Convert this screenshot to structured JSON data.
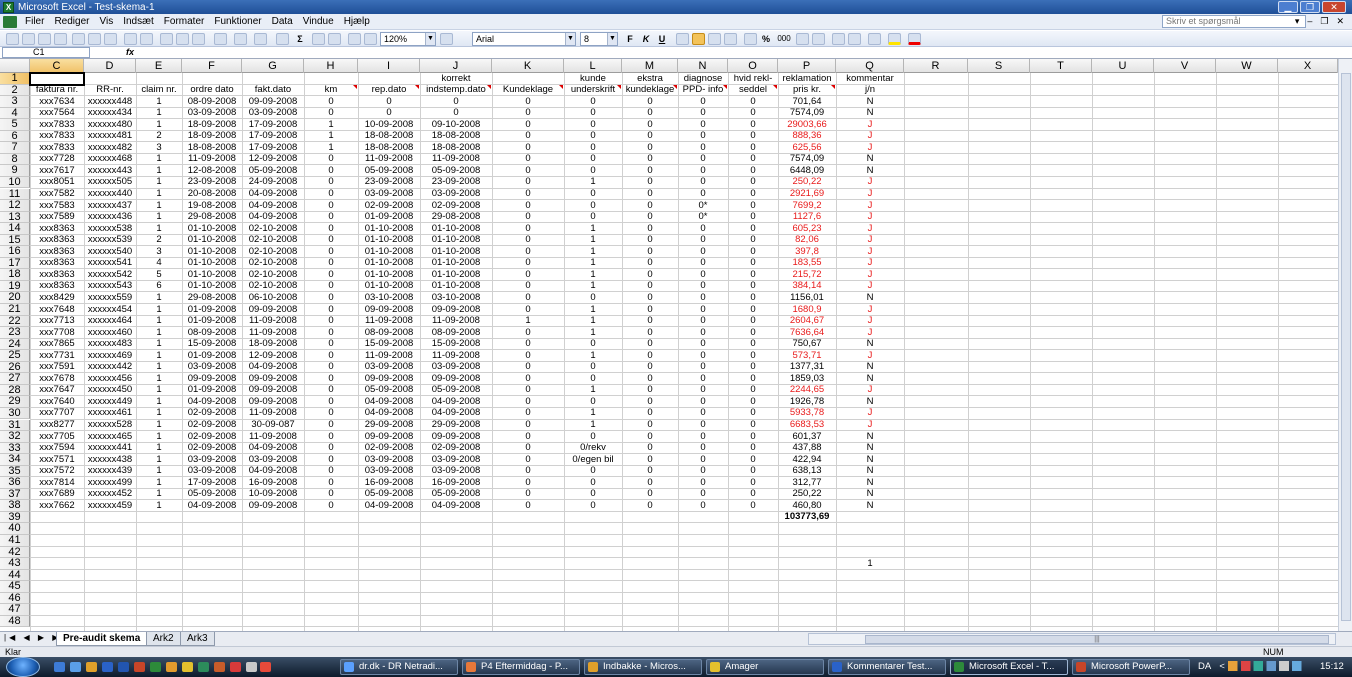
{
  "window": {
    "title": "Microsoft Excel - Test-skema-1",
    "icon_name": "excel-icon"
  },
  "menu": [
    "Filer",
    "Rediger",
    "Vis",
    "Indsæt",
    "Formater",
    "Funktioner",
    "Data",
    "Vindue",
    "Hjælp"
  ],
  "help_box": {
    "placeholder": "Skriv et spørgsmål"
  },
  "toolbar": {
    "zoom": "120%",
    "font": "Arial",
    "font_size": "8",
    "sum_symbol": "Σ",
    "bold_label": "F",
    "italic_label": "K",
    "underline_label": "U",
    "percent": "%",
    "thousands": "000"
  },
  "formula_bar": {
    "name_box": "C1",
    "fx": "fx",
    "content": ""
  },
  "columns": [
    "C",
    "D",
    "E",
    "F",
    "G",
    "H",
    "I",
    "J",
    "K",
    "L",
    "M",
    "N",
    "O",
    "P",
    "Q",
    "R",
    "S",
    "T",
    "U",
    "V",
    "W",
    "X"
  ],
  "rows": [
    "1",
    "2",
    "3",
    "4",
    "5",
    "6",
    "7",
    "8",
    "9",
    "10",
    "11",
    "12",
    "13",
    "14",
    "15",
    "16",
    "17",
    "18",
    "19",
    "20",
    "21",
    "22",
    "23",
    "24",
    "25",
    "26",
    "27",
    "28",
    "29",
    "30",
    "31",
    "32",
    "33",
    "34",
    "35",
    "36",
    "37",
    "38",
    "39",
    "40",
    "41",
    "42",
    "43",
    "44",
    "45",
    "46",
    "47",
    "48"
  ],
  "header_row1": [
    "",
    "",
    "",
    "",
    "",
    "",
    "",
    "korrekt",
    "",
    "kunde",
    "ekstra",
    "diagnose",
    "hvid rekl-",
    "reklamation",
    "kommentar"
  ],
  "header_row2": [
    "faktura nr.",
    "RR-nr.",
    "claim nr.",
    "ordre dato",
    "fakt.dato",
    "km",
    "rep.dato",
    "indstemp.dato",
    "Kundeklage",
    "underskrift",
    "kundeklage",
    "PPD- info",
    "seddel",
    "pris kr.",
    "j/n"
  ],
  "data_rows": [
    [
      "xxx7634",
      "xxxxxx448",
      "1",
      "08-09-2008",
      "09-09-2008",
      "0",
      "0",
      "0",
      "0",
      "0",
      "0",
      "0",
      "0",
      "701,64",
      "N"
    ],
    [
      "xxx7564",
      "xxxxxx434",
      "1",
      "03-09-2008",
      "03-09-2008",
      "0",
      "0",
      "0",
      "0",
      "0",
      "0",
      "0",
      "0",
      "7574,09",
      "N"
    ],
    [
      "xxx7833",
      "xxxxxx480",
      "1",
      "18-09-2008",
      "17-09-2008",
      "1",
      "10-09-2008",
      "09-10-2008",
      "0",
      "0",
      "0",
      "0",
      "0",
      "29003,66",
      "J"
    ],
    [
      "xxx7833",
      "xxxxxx481",
      "2",
      "18-09-2008",
      "17-09-2008",
      "1",
      "18-08-2008",
      "18-08-2008",
      "0",
      "0",
      "0",
      "0",
      "0",
      "888,36",
      "J"
    ],
    [
      "xxx7833",
      "xxxxxx482",
      "3",
      "18-08-2008",
      "17-09-2008",
      "1",
      "18-08-2008",
      "18-08-2008",
      "0",
      "0",
      "0",
      "0",
      "0",
      "625,56",
      "J"
    ],
    [
      "xxx7728",
      "xxxxxx468",
      "1",
      "11-09-2008",
      "12-09-2008",
      "0",
      "11-09-2008",
      "11-09-2008",
      "0",
      "0",
      "0",
      "0",
      "0",
      "7574,09",
      "N"
    ],
    [
      "xxx7617",
      "xxxxxx443",
      "1",
      "12-08-2008",
      "05-09-2008",
      "0",
      "05-09-2008",
      "05-09-2008",
      "0",
      "0",
      "0",
      "0",
      "0",
      "6448,09",
      "N"
    ],
    [
      "xxx8051",
      "xxxxxx505",
      "1",
      "23-09-2008",
      "24-09-2008",
      "0",
      "23-09-2008",
      "23-09-2008",
      "0",
      "1",
      "0",
      "0",
      "0",
      "250,22",
      "J"
    ],
    [
      "xxx7582",
      "xxxxxx440",
      "1",
      "20-08-2008",
      "04-09-2008",
      "0",
      "03-09-2008",
      "03-09-2008",
      "0",
      "0",
      "0",
      "0",
      "0",
      "2921,69",
      "J"
    ],
    [
      "xxx7583",
      "xxxxxx437",
      "1",
      "19-08-2008",
      "04-09-2008",
      "0",
      "02-09-2008",
      "02-09-2008",
      "0",
      "0",
      "0",
      "0*",
      "0",
      "7699,2",
      "J"
    ],
    [
      "xxx7589",
      "xxxxxx436",
      "1",
      "29-08-2008",
      "04-09-2008",
      "0",
      "01-09-2008",
      "29-08-2008",
      "0",
      "0",
      "0",
      "0*",
      "0",
      "1127,6",
      "J"
    ],
    [
      "xxx8363",
      "xxxxxx538",
      "1",
      "01-10-2008",
      "02-10-2008",
      "0",
      "01-10-2008",
      "01-10-2008",
      "0",
      "1",
      "0",
      "0",
      "0",
      "605,23",
      "J"
    ],
    [
      "xxx8363",
      "xxxxxx539",
      "2",
      "01-10-2008",
      "02-10-2008",
      "0",
      "01-10-2008",
      "01-10-2008",
      "0",
      "1",
      "0",
      "0",
      "0",
      "82,06",
      "J"
    ],
    [
      "xxx8363",
      "xxxxxx540",
      "3",
      "01-10-2008",
      "02-10-2008",
      "0",
      "01-10-2008",
      "01-10-2008",
      "0",
      "1",
      "0",
      "0",
      "0",
      "397,8",
      "J"
    ],
    [
      "xxx8363",
      "xxxxxx541",
      "4",
      "01-10-2008",
      "02-10-2008",
      "0",
      "01-10-2008",
      "01-10-2008",
      "0",
      "1",
      "0",
      "0",
      "0",
      "183,55",
      "J"
    ],
    [
      "xxx8363",
      "xxxxxx542",
      "5",
      "01-10-2008",
      "02-10-2008",
      "0",
      "01-10-2008",
      "01-10-2008",
      "0",
      "1",
      "0",
      "0",
      "0",
      "215,72",
      "J"
    ],
    [
      "xxx8363",
      "xxxxxx543",
      "6",
      "01-10-2008",
      "02-10-2008",
      "0",
      "01-10-2008",
      "01-10-2008",
      "0",
      "1",
      "0",
      "0",
      "0",
      "384,14",
      "J"
    ],
    [
      "xxx8429",
      "xxxxxx559",
      "1",
      "29-08-2008",
      "06-10-2008",
      "0",
      "03-10-2008",
      "03-10-2008",
      "0",
      "0",
      "0",
      "0",
      "0",
      "1156,01",
      "N"
    ],
    [
      "xxx7648",
      "xxxxxx454",
      "1",
      "01-09-2008",
      "09-09-2008",
      "0",
      "09-09-2008",
      "09-09-2008",
      "0",
      "1",
      "0",
      "0",
      "0",
      "1680,9",
      "J"
    ],
    [
      "xxx7713",
      "xxxxxx464",
      "1",
      "01-09-2008",
      "11-09-2008",
      "0",
      "11-09-2008",
      "11-09-2008",
      "1",
      "1",
      "0",
      "0",
      "0",
      "2604,67",
      "J"
    ],
    [
      "xxx7708",
      "xxxxxx460",
      "1",
      "08-09-2008",
      "11-09-2008",
      "0",
      "08-09-2008",
      "08-09-2008",
      "0",
      "1",
      "0",
      "0",
      "0",
      "7636,64",
      "J"
    ],
    [
      "xxx7865",
      "xxxxxx483",
      "1",
      "15-09-2008",
      "18-09-2008",
      "0",
      "15-09-2008",
      "15-09-2008",
      "0",
      "0",
      "0",
      "0",
      "0",
      "750,67",
      "N"
    ],
    [
      "xxx7731",
      "xxxxxx469",
      "1",
      "01-09-2008",
      "12-09-2008",
      "0",
      "11-09-2008",
      "11-09-2008",
      "0",
      "1",
      "0",
      "0",
      "0",
      "573,71",
      "J"
    ],
    [
      "xxx7591",
      "xxxxxx442",
      "1",
      "03-09-2008",
      "04-09-2008",
      "0",
      "03-09-2008",
      "03-09-2008",
      "0",
      "0",
      "0",
      "0",
      "0",
      "1377,31",
      "N"
    ],
    [
      "xxx7678",
      "xxxxxx456",
      "1",
      "09-09-2008",
      "09-09-2008",
      "0",
      "09-09-2008",
      "09-09-2008",
      "0",
      "0",
      "0",
      "0",
      "0",
      "1859,03",
      "N"
    ],
    [
      "xxx7647",
      "xxxxxx450",
      "1",
      "01-09-2008",
      "09-09-2008",
      "0",
      "05-09-2008",
      "05-09-2008",
      "0",
      "1",
      "0",
      "0",
      "0",
      "2244,65",
      "J"
    ],
    [
      "xxx7640",
      "xxxxxx449",
      "1",
      "04-09-2008",
      "09-09-2008",
      "0",
      "04-09-2008",
      "04-09-2008",
      "0",
      "0",
      "0",
      "0",
      "0",
      "1926,78",
      "N"
    ],
    [
      "xxx7707",
      "xxxxxx461",
      "1",
      "02-09-2008",
      "11-09-2008",
      "0",
      "04-09-2008",
      "04-09-2008",
      "0",
      "1",
      "0",
      "0",
      "0",
      "5933,78",
      "J"
    ],
    [
      "xxx8277",
      "xxxxxx528",
      "1",
      "02-09-2008",
      "30-09-087",
      "0",
      "29-09-2008",
      "29-09-2008",
      "0",
      "1",
      "0",
      "0",
      "0",
      "6683,53",
      "J"
    ],
    [
      "xxx7705",
      "xxxxxx465",
      "1",
      "02-09-2008",
      "11-09-2008",
      "0",
      "09-09-2008",
      "09-09-2008",
      "0",
      "0",
      "0",
      "0",
      "0",
      "601,37",
      "N"
    ],
    [
      "xxx7594",
      "xxxxxx441",
      "1",
      "02-09-2008",
      "04-09-2008",
      "0",
      "02-09-2008",
      "02-09-2008",
      "0",
      "0/rekv",
      "0",
      "0",
      "0",
      "437,88",
      "N"
    ],
    [
      "xxx7571",
      "xxxxxx438",
      "1",
      "03-09-2008",
      "03-09-2008",
      "0",
      "03-09-2008",
      "03-09-2008",
      "0",
      "0/egen bil",
      "0",
      "0",
      "0",
      "422,94",
      "N"
    ],
    [
      "xxx7572",
      "xxxxxx439",
      "1",
      "03-09-2008",
      "04-09-2008",
      "0",
      "03-09-2008",
      "03-09-2008",
      "0",
      "0",
      "0",
      "0",
      "0",
      "638,13",
      "N"
    ],
    [
      "xxx7814",
      "xxxxxx499",
      "1",
      "17-09-2008",
      "16-09-2008",
      "0",
      "16-09-2008",
      "16-09-2008",
      "0",
      "0",
      "0",
      "0",
      "0",
      "312,77",
      "N"
    ],
    [
      "xxx7689",
      "xxxxxx452",
      "1",
      "05-09-2008",
      "10-09-2008",
      "0",
      "05-09-2008",
      "05-09-2008",
      "0",
      "0",
      "0",
      "0",
      "0",
      "250,22",
      "N"
    ],
    [
      "xxx7662",
      "xxxxxx459",
      "1",
      "04-09-2008",
      "09-09-2008",
      "0",
      "04-09-2008",
      "04-09-2008",
      "0",
      "0",
      "0",
      "0",
      "0",
      "460,80",
      "N"
    ]
  ],
  "total": "103773,69",
  "q43_value": "1",
  "sheets": [
    "Pre-audit skema",
    "Ark2",
    "Ark3"
  ],
  "status": {
    "left": "Klar",
    "num": "NUM"
  },
  "taskbar": {
    "tasks": [
      "dr.dk - DR Netradi...",
      "P4 Eftermiddag - P...",
      "Indbakke - Micros...",
      "Amager",
      "Kommentarer Test...",
      "Microsoft Excel - T...",
      "Microsoft PowerP..."
    ],
    "lang": "DA",
    "clock": "15:12"
  },
  "colors": {
    "red_text": "#e81a1a",
    "title_blue": "#1f4f97"
  }
}
